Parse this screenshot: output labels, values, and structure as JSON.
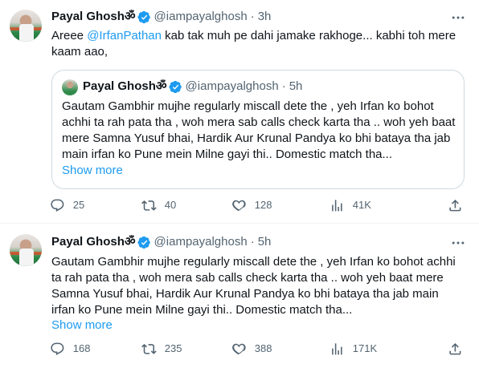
{
  "tweets": [
    {
      "author": {
        "name": "Payal Ghoshॐ",
        "handle": "@iampayalghosh",
        "time": "3h"
      },
      "text_before": "Areee ",
      "mention": "@IrfanPathan",
      "text_after": " kab tak muh pe dahi jamake rakhoge... kabhi toh mere kaam aao,",
      "quote": {
        "author": {
          "name": "Payal Ghoshॐ",
          "handle": "@iampayalghosh",
          "time": "5h"
        },
        "text": "Gautam Gambhir mujhe regularly miscall dete  the , yeh Irfan ko bohot achhi ta rah pata tha , woh mera sab calls check karta tha .. woh yeh baat mere Samna Yusuf bhai, Hardik  Aur Krunal Pandya ko bhi bataya tha jab main irfan ko Pune mein Milne gayi thi.. Domestic match tha...",
        "show_more": "Show more"
      },
      "stats": {
        "replies": "25",
        "reposts": "40",
        "likes": "128",
        "views": "41K"
      }
    },
    {
      "author": {
        "name": "Payal Ghoshॐ",
        "handle": "@iampayalghosh",
        "time": "5h"
      },
      "text": "Gautam Gambhir mujhe regularly miscall dete  the , yeh Irfan ko bohot achhi ta rah pata tha , woh mera sab calls check karta tha .. woh yeh baat mere Samna Yusuf bhai, Hardik  Aur Krunal Pandya ko bhi bataya tha jab main irfan ko Pune mein Milne gayi thi.. Domestic match tha...",
      "show_more": "Show more",
      "stats": {
        "replies": "168",
        "reposts": "235",
        "likes": "388",
        "views": "171K"
      }
    }
  ],
  "separator": "·",
  "colors": {
    "accent": "#1d9bf0",
    "muted": "#536471",
    "text": "#0f1419",
    "border": "#cfd9de"
  },
  "icons": [
    "verified-badge-icon",
    "more-icon",
    "reply-icon",
    "repost-icon",
    "like-icon",
    "views-icon",
    "share-icon"
  ]
}
